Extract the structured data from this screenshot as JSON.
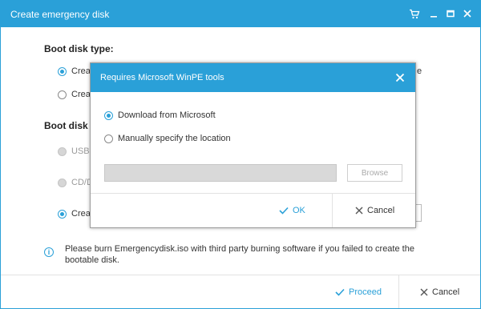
{
  "window": {
    "title": "Create emergency disk",
    "controls": [
      "cart-icon",
      "minimize-icon",
      "maximize-icon",
      "close-icon"
    ]
  },
  "boot_disk_type": {
    "heading": "Boot disk type:",
    "options": [
      {
        "label": "Creat",
        "checked": true
      },
      {
        "label": "Creat",
        "checked": false
      }
    ],
    "partial_text": "e"
  },
  "boot_disk_location": {
    "heading": "Boot disk lo",
    "options": [
      {
        "label": "USB",
        "checked": false,
        "disabled": true
      },
      {
        "label": "CD/D",
        "checked": false,
        "disabled": true
      },
      {
        "label": "Creat",
        "checked": true,
        "disabled": false
      }
    ]
  },
  "info": {
    "icon": "info-icon",
    "text": "Please burn Emergencydisk.iso with third party burning software if you failed to create the bootable disk."
  },
  "footer": {
    "proceed_label": "Proceed",
    "cancel_label": "Cancel"
  },
  "dialog": {
    "title": "Requires Microsoft WinPE tools",
    "options": [
      {
        "label": "Download from Microsoft",
        "checked": true
      },
      {
        "label": "Manually specify the location",
        "checked": false
      }
    ],
    "path_value": "",
    "browse_label": "Browse",
    "ok_label": "OK",
    "cancel_label": "Cancel"
  },
  "colors": {
    "accent": "#2aa0d8",
    "text": "#333333",
    "disabled": "#9a9a9a"
  }
}
